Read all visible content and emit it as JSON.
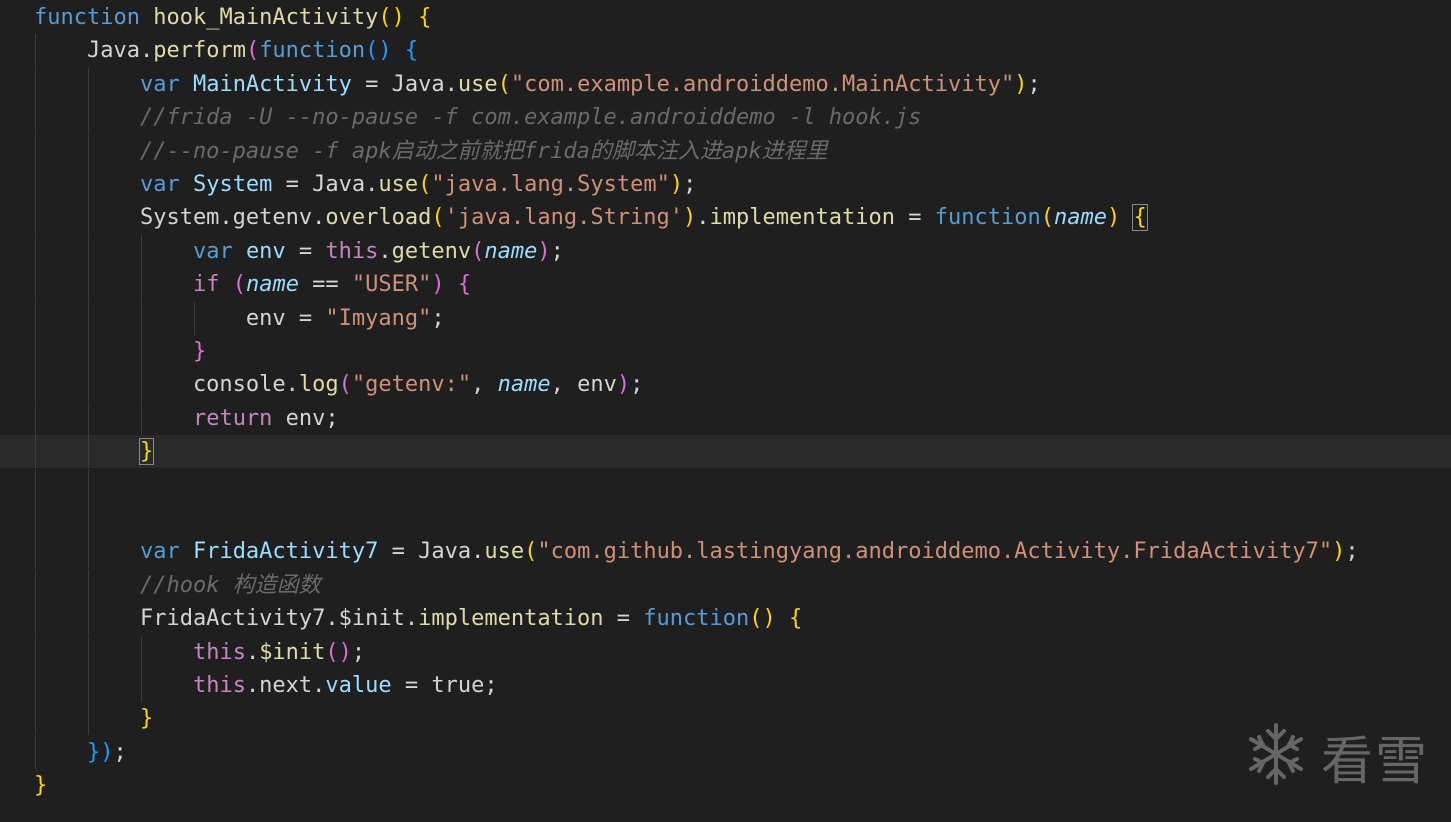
{
  "editor": {
    "lines": [
      [
        [
          "function ",
          "kw-blue"
        ],
        [
          "hook_MainActivity",
          "fn"
        ],
        [
          "() {",
          "b1"
        ]
      ],
      [
        [
          "    Java.",
          "plain"
        ],
        [
          "perform",
          "fn"
        ],
        [
          "(",
          "b2"
        ],
        [
          "function",
          "kw-blue"
        ],
        [
          "() {",
          "b3"
        ]
      ],
      [
        [
          "        ",
          "plain"
        ],
        [
          "var ",
          "kw-blue"
        ],
        [
          "MainActivity",
          "var"
        ],
        [
          " = Java.",
          "plain"
        ],
        [
          "use",
          "fn"
        ],
        [
          "(",
          "b1"
        ],
        [
          "\"com.example.androiddemo.MainActivity\"",
          "str"
        ],
        [
          ")",
          "b1"
        ],
        [
          ";",
          "plain"
        ]
      ],
      [
        [
          "        //frida -U --no-pause -f com.example.androiddemo -l hook.js",
          "cmt-gray"
        ]
      ],
      [
        [
          "        //--no-pause -f apk启动之前就把frida的脚本注入进apk进程里",
          "cmt-gray"
        ]
      ],
      [
        [
          "        ",
          "plain"
        ],
        [
          "var ",
          "kw-blue"
        ],
        [
          "System",
          "var"
        ],
        [
          " = Java.",
          "plain"
        ],
        [
          "use",
          "fn"
        ],
        [
          "(",
          "b1"
        ],
        [
          "\"java.lang.System\"",
          "str"
        ],
        [
          ")",
          "b1"
        ],
        [
          ";",
          "plain"
        ]
      ],
      [
        [
          "        System.getenv.",
          "plain"
        ],
        [
          "overload",
          "fn"
        ],
        [
          "(",
          "b1"
        ],
        [
          "'java.lang.String'",
          "str"
        ],
        [
          ")",
          "b1"
        ],
        [
          ".",
          "plain"
        ],
        [
          "implementation",
          "fn"
        ],
        [
          " = ",
          "plain"
        ],
        [
          "function",
          "kw-blue"
        ],
        [
          "(",
          "b1"
        ],
        [
          "name",
          "param"
        ],
        [
          ")",
          "b1"
        ],
        [
          " ",
          "plain"
        ],
        [
          "{",
          "b1"
        ]
      ],
      [
        [
          "            ",
          "plain"
        ],
        [
          "var ",
          "kw-blue"
        ],
        [
          "env",
          "var"
        ],
        [
          " = ",
          "plain"
        ],
        [
          "this",
          "kw-purple"
        ],
        [
          ".",
          "plain"
        ],
        [
          "getenv",
          "fn"
        ],
        [
          "(",
          "b2"
        ],
        [
          "name",
          "param"
        ],
        [
          ")",
          "b2"
        ],
        [
          ";",
          "plain"
        ]
      ],
      [
        [
          "            ",
          "plain"
        ],
        [
          "if ",
          "kw-purple"
        ],
        [
          "(",
          "b2"
        ],
        [
          "name",
          "param"
        ],
        [
          " == ",
          "plain"
        ],
        [
          "\"USER\"",
          "str"
        ],
        [
          ") ",
          "b2"
        ],
        [
          "{",
          "b2"
        ]
      ],
      [
        [
          "                env = ",
          "plain"
        ],
        [
          "\"Imyang\"",
          "str"
        ],
        [
          ";",
          "plain"
        ]
      ],
      [
        [
          "            ",
          "plain"
        ],
        [
          "}",
          "b2"
        ]
      ],
      [
        [
          "            console.",
          "plain"
        ],
        [
          "log",
          "fn"
        ],
        [
          "(",
          "b2"
        ],
        [
          "\"getenv:\"",
          "str"
        ],
        [
          ", ",
          "plain"
        ],
        [
          "name",
          "param"
        ],
        [
          ", env",
          "plain"
        ],
        [
          ")",
          "b2"
        ],
        [
          ";",
          "plain"
        ]
      ],
      [
        [
          "            ",
          "plain"
        ],
        [
          "return ",
          "kw-purple"
        ],
        [
          "env;",
          "plain"
        ]
      ],
      [
        [
          "        ",
          "plain"
        ],
        [
          "}",
          "b1"
        ]
      ],
      [
        [
          "",
          "plain"
        ]
      ],
      [
        [
          "",
          "plain"
        ]
      ],
      [
        [
          "        ",
          "plain"
        ],
        [
          "var ",
          "kw-blue"
        ],
        [
          "FridaActivity7",
          "var"
        ],
        [
          " = Java.",
          "plain"
        ],
        [
          "use",
          "fn"
        ],
        [
          "(",
          "b1"
        ],
        [
          "\"com.github.lastingyang.androiddemo.Activity.FridaActivity7\"",
          "str"
        ],
        [
          ")",
          "b1"
        ],
        [
          ";",
          "plain"
        ]
      ],
      [
        [
          "        //hook 构造函数",
          "cmt-gray"
        ]
      ],
      [
        [
          "        FridaActivity7.$init.",
          "plain"
        ],
        [
          "implementation",
          "fn"
        ],
        [
          " = ",
          "plain"
        ],
        [
          "function",
          "kw-blue"
        ],
        [
          "() {",
          "b1"
        ]
      ],
      [
        [
          "            ",
          "plain"
        ],
        [
          "this",
          "kw-purple"
        ],
        [
          ".",
          "plain"
        ],
        [
          "$init",
          "fn"
        ],
        [
          "()",
          "b2"
        ],
        [
          ";",
          "plain"
        ]
      ],
      [
        [
          "            ",
          "plain"
        ],
        [
          "this",
          "kw-purple"
        ],
        [
          ".next.",
          "plain"
        ],
        [
          "value",
          "var"
        ],
        [
          " = true;",
          "plain"
        ]
      ],
      [
        [
          "        ",
          "plain"
        ],
        [
          "}",
          "b1"
        ]
      ],
      [
        [
          "    ",
          "plain"
        ],
        [
          "})",
          "b3"
        ],
        [
          ";",
          "plain"
        ]
      ],
      [
        [
          "}",
          "b1"
        ]
      ]
    ]
  },
  "watermark": {
    "text": "看雪",
    "icon": "snowflake-icon"
  }
}
